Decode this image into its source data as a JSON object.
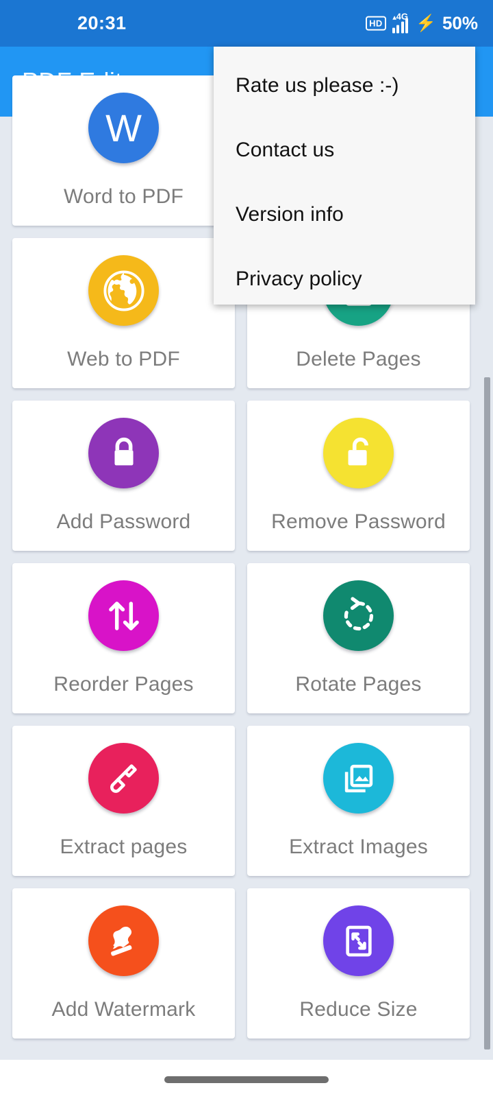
{
  "status_bar": {
    "time": "20:31",
    "hd_label": "HD",
    "network_caret": "▲",
    "network_type": "4G",
    "battery_percent": "50%",
    "charging_icon": "⚡",
    "signal_icon": "signal-bars-icon",
    "background_color": "#1b76d2"
  },
  "app_bar": {
    "title": "PDF Editor",
    "background_color": "#2196f3",
    "title_color": "#f2f9ff"
  },
  "overflow_menu": {
    "visible": true,
    "background_color": "#f7f7f7",
    "items": [
      {
        "label": "Rate us please :-)",
        "name": "menu-item-rate-us"
      },
      {
        "label": "Contact us",
        "name": "menu-item-contact-us"
      },
      {
        "label": "Version info",
        "name": "menu-item-version-info"
      },
      {
        "label": "Privacy policy",
        "name": "menu-item-privacy-policy"
      }
    ]
  },
  "tool_grid": {
    "background_color": "#e4e9f0",
    "card_color": "#ffffff",
    "label_color": "#7c7c7c",
    "cards": [
      {
        "label": "Word to PDF",
        "icon": "word-doc-icon",
        "color": "#2f7ae0"
      },
      {
        "label": "",
        "icon": "hidden-behind-menu",
        "color": "#f7f7f7"
      },
      {
        "label": "Web to PDF",
        "icon": "globe-icon",
        "color": "#f5b91a"
      },
      {
        "label": "Delete Pages",
        "icon": "delete-page-icon",
        "color": "#17a384"
      },
      {
        "label": "Add Password",
        "icon": "lock-closed-icon",
        "color": "#8e35b8"
      },
      {
        "label": "Remove Password",
        "icon": "lock-open-icon",
        "color": "#f5e231"
      },
      {
        "label": "Reorder Pages",
        "icon": "arrows-up-down-icon",
        "color": "#d813c8"
      },
      {
        "label": "Rotate Pages",
        "icon": "rotate-ccw-icon",
        "color": "#10896f"
      },
      {
        "label": "Extract pages",
        "icon": "shovel-icon",
        "color": "#e8215c"
      },
      {
        "label": "Extract Images",
        "icon": "photo-stack-icon",
        "color": "#1cb8d9"
      },
      {
        "label": "Add Watermark",
        "icon": "stamp-icon",
        "color": "#f5501c"
      },
      {
        "label": "Reduce Size",
        "icon": "compress-arrows-icon",
        "color": "#7043e8"
      }
    ]
  },
  "scrollbar": {
    "name": "vertical-scrollbar",
    "color": "#9ea4ad"
  },
  "nav_bar": {
    "gesture_pill_color": "#6e6e6e",
    "background_color": "#ffffff"
  }
}
